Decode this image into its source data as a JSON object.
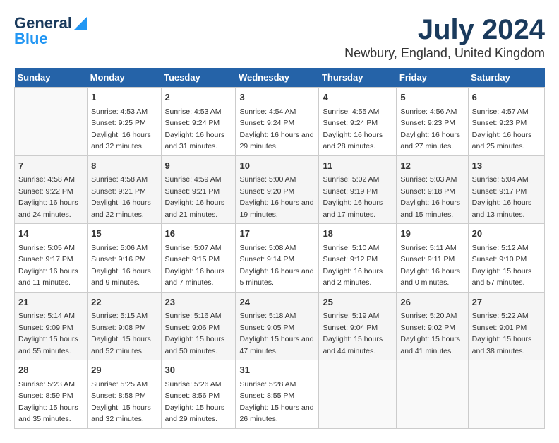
{
  "logo": {
    "general": "General",
    "blue": "Blue"
  },
  "title": {
    "month_year": "July 2024",
    "location": "Newbury, England, United Kingdom"
  },
  "days_of_week": [
    "Sunday",
    "Monday",
    "Tuesday",
    "Wednesday",
    "Thursday",
    "Friday",
    "Saturday"
  ],
  "weeks": [
    [
      {
        "day": "",
        "sunrise": "",
        "sunset": "",
        "daylight": ""
      },
      {
        "day": "1",
        "sunrise": "Sunrise: 4:53 AM",
        "sunset": "Sunset: 9:25 PM",
        "daylight": "Daylight: 16 hours and 32 minutes."
      },
      {
        "day": "2",
        "sunrise": "Sunrise: 4:53 AM",
        "sunset": "Sunset: 9:24 PM",
        "daylight": "Daylight: 16 hours and 31 minutes."
      },
      {
        "day": "3",
        "sunrise": "Sunrise: 4:54 AM",
        "sunset": "Sunset: 9:24 PM",
        "daylight": "Daylight: 16 hours and 29 minutes."
      },
      {
        "day": "4",
        "sunrise": "Sunrise: 4:55 AM",
        "sunset": "Sunset: 9:24 PM",
        "daylight": "Daylight: 16 hours and 28 minutes."
      },
      {
        "day": "5",
        "sunrise": "Sunrise: 4:56 AM",
        "sunset": "Sunset: 9:23 PM",
        "daylight": "Daylight: 16 hours and 27 minutes."
      },
      {
        "day": "6",
        "sunrise": "Sunrise: 4:57 AM",
        "sunset": "Sunset: 9:23 PM",
        "daylight": "Daylight: 16 hours and 25 minutes."
      }
    ],
    [
      {
        "day": "7",
        "sunrise": "Sunrise: 4:58 AM",
        "sunset": "Sunset: 9:22 PM",
        "daylight": "Daylight: 16 hours and 24 minutes."
      },
      {
        "day": "8",
        "sunrise": "Sunrise: 4:58 AM",
        "sunset": "Sunset: 9:21 PM",
        "daylight": "Daylight: 16 hours and 22 minutes."
      },
      {
        "day": "9",
        "sunrise": "Sunrise: 4:59 AM",
        "sunset": "Sunset: 9:21 PM",
        "daylight": "Daylight: 16 hours and 21 minutes."
      },
      {
        "day": "10",
        "sunrise": "Sunrise: 5:00 AM",
        "sunset": "Sunset: 9:20 PM",
        "daylight": "Daylight: 16 hours and 19 minutes."
      },
      {
        "day": "11",
        "sunrise": "Sunrise: 5:02 AM",
        "sunset": "Sunset: 9:19 PM",
        "daylight": "Daylight: 16 hours and 17 minutes."
      },
      {
        "day": "12",
        "sunrise": "Sunrise: 5:03 AM",
        "sunset": "Sunset: 9:18 PM",
        "daylight": "Daylight: 16 hours and 15 minutes."
      },
      {
        "day": "13",
        "sunrise": "Sunrise: 5:04 AM",
        "sunset": "Sunset: 9:17 PM",
        "daylight": "Daylight: 16 hours and 13 minutes."
      }
    ],
    [
      {
        "day": "14",
        "sunrise": "Sunrise: 5:05 AM",
        "sunset": "Sunset: 9:17 PM",
        "daylight": "Daylight: 16 hours and 11 minutes."
      },
      {
        "day": "15",
        "sunrise": "Sunrise: 5:06 AM",
        "sunset": "Sunset: 9:16 PM",
        "daylight": "Daylight: 16 hours and 9 minutes."
      },
      {
        "day": "16",
        "sunrise": "Sunrise: 5:07 AM",
        "sunset": "Sunset: 9:15 PM",
        "daylight": "Daylight: 16 hours and 7 minutes."
      },
      {
        "day": "17",
        "sunrise": "Sunrise: 5:08 AM",
        "sunset": "Sunset: 9:14 PM",
        "daylight": "Daylight: 16 hours and 5 minutes."
      },
      {
        "day": "18",
        "sunrise": "Sunrise: 5:10 AM",
        "sunset": "Sunset: 9:12 PM",
        "daylight": "Daylight: 16 hours and 2 minutes."
      },
      {
        "day": "19",
        "sunrise": "Sunrise: 5:11 AM",
        "sunset": "Sunset: 9:11 PM",
        "daylight": "Daylight: 16 hours and 0 minutes."
      },
      {
        "day": "20",
        "sunrise": "Sunrise: 5:12 AM",
        "sunset": "Sunset: 9:10 PM",
        "daylight": "Daylight: 15 hours and 57 minutes."
      }
    ],
    [
      {
        "day": "21",
        "sunrise": "Sunrise: 5:14 AM",
        "sunset": "Sunset: 9:09 PM",
        "daylight": "Daylight: 15 hours and 55 minutes."
      },
      {
        "day": "22",
        "sunrise": "Sunrise: 5:15 AM",
        "sunset": "Sunset: 9:08 PM",
        "daylight": "Daylight: 15 hours and 52 minutes."
      },
      {
        "day": "23",
        "sunrise": "Sunrise: 5:16 AM",
        "sunset": "Sunset: 9:06 PM",
        "daylight": "Daylight: 15 hours and 50 minutes."
      },
      {
        "day": "24",
        "sunrise": "Sunrise: 5:18 AM",
        "sunset": "Sunset: 9:05 PM",
        "daylight": "Daylight: 15 hours and 47 minutes."
      },
      {
        "day": "25",
        "sunrise": "Sunrise: 5:19 AM",
        "sunset": "Sunset: 9:04 PM",
        "daylight": "Daylight: 15 hours and 44 minutes."
      },
      {
        "day": "26",
        "sunrise": "Sunrise: 5:20 AM",
        "sunset": "Sunset: 9:02 PM",
        "daylight": "Daylight: 15 hours and 41 minutes."
      },
      {
        "day": "27",
        "sunrise": "Sunrise: 5:22 AM",
        "sunset": "Sunset: 9:01 PM",
        "daylight": "Daylight: 15 hours and 38 minutes."
      }
    ],
    [
      {
        "day": "28",
        "sunrise": "Sunrise: 5:23 AM",
        "sunset": "Sunset: 8:59 PM",
        "daylight": "Daylight: 15 hours and 35 minutes."
      },
      {
        "day": "29",
        "sunrise": "Sunrise: 5:25 AM",
        "sunset": "Sunset: 8:58 PM",
        "daylight": "Daylight: 15 hours and 32 minutes."
      },
      {
        "day": "30",
        "sunrise": "Sunrise: 5:26 AM",
        "sunset": "Sunset: 8:56 PM",
        "daylight": "Daylight: 15 hours and 29 minutes."
      },
      {
        "day": "31",
        "sunrise": "Sunrise: 5:28 AM",
        "sunset": "Sunset: 8:55 PM",
        "daylight": "Daylight: 15 hours and 26 minutes."
      },
      {
        "day": "",
        "sunrise": "",
        "sunset": "",
        "daylight": ""
      },
      {
        "day": "",
        "sunrise": "",
        "sunset": "",
        "daylight": ""
      },
      {
        "day": "",
        "sunrise": "",
        "sunset": "",
        "daylight": ""
      }
    ]
  ]
}
